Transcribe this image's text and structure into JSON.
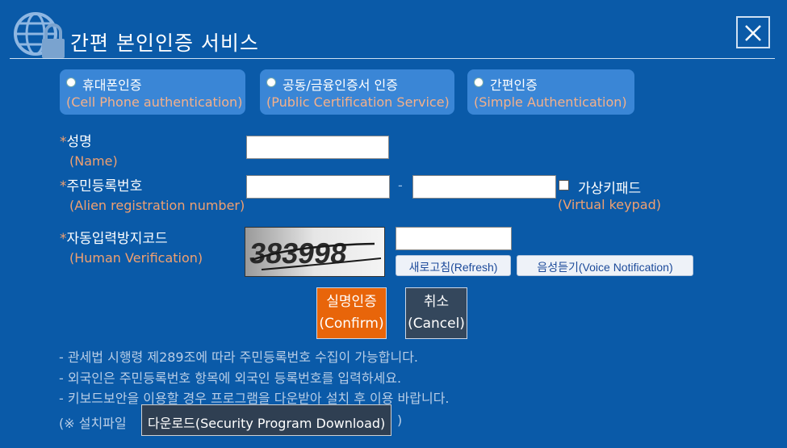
{
  "header": {
    "title": "간편 본인인증 서비스",
    "close_label": "Close"
  },
  "tabs": [
    {
      "ko": "휴대폰인증",
      "en": "(Cell Phone authentication)"
    },
    {
      "ko": "공동/금융인증서 인증",
      "en": "(Public Certification Service)"
    },
    {
      "ko": "간편인증",
      "en": "(Simple Authentication)"
    }
  ],
  "form": {
    "star": "*",
    "name": {
      "ko": "성명",
      "en": "(Name)",
      "value": ""
    },
    "reg": {
      "ko": "주민등록번호",
      "en": "(Alien registration number)",
      "value1": "",
      "value2": "",
      "separator": "-"
    },
    "virtual_keypad": {
      "ko": "가상키패드",
      "en": "(Virtual keypad)",
      "checked": false
    },
    "captcha": {
      "ko": "자동입력방지코드",
      "en": "(Human Verification)",
      "code": "383998",
      "value": ""
    },
    "refresh_label": "새로고침(Refresh)",
    "voice_label": "음성듣기(Voice Notification)"
  },
  "actions": {
    "confirm_ko": "실명인증",
    "confirm_en": "(Confirm)",
    "cancel_ko": "취소",
    "cancel_en": "(Cancel)"
  },
  "notes": [
    "- 관세법 시행령 제289조에 따라 주민등록번호 수집이 가능합니다.",
    "- 외국인은 주민등록번호 항목에 외국인 등록번호를 입력하세요.",
    "- 키보드보안을 이용할 경우 프로그램을 다운받아 설치 후 이용 바랍니다."
  ],
  "download": {
    "prefix": "(※ 설치파일",
    "button": "다운로드(Security Program Download)",
    "suffix": ")"
  },
  "colors": {
    "background": "#0a5aa8",
    "accent_text": "#f0a070",
    "confirm": "#e8650a",
    "cancel": "#34475c"
  }
}
